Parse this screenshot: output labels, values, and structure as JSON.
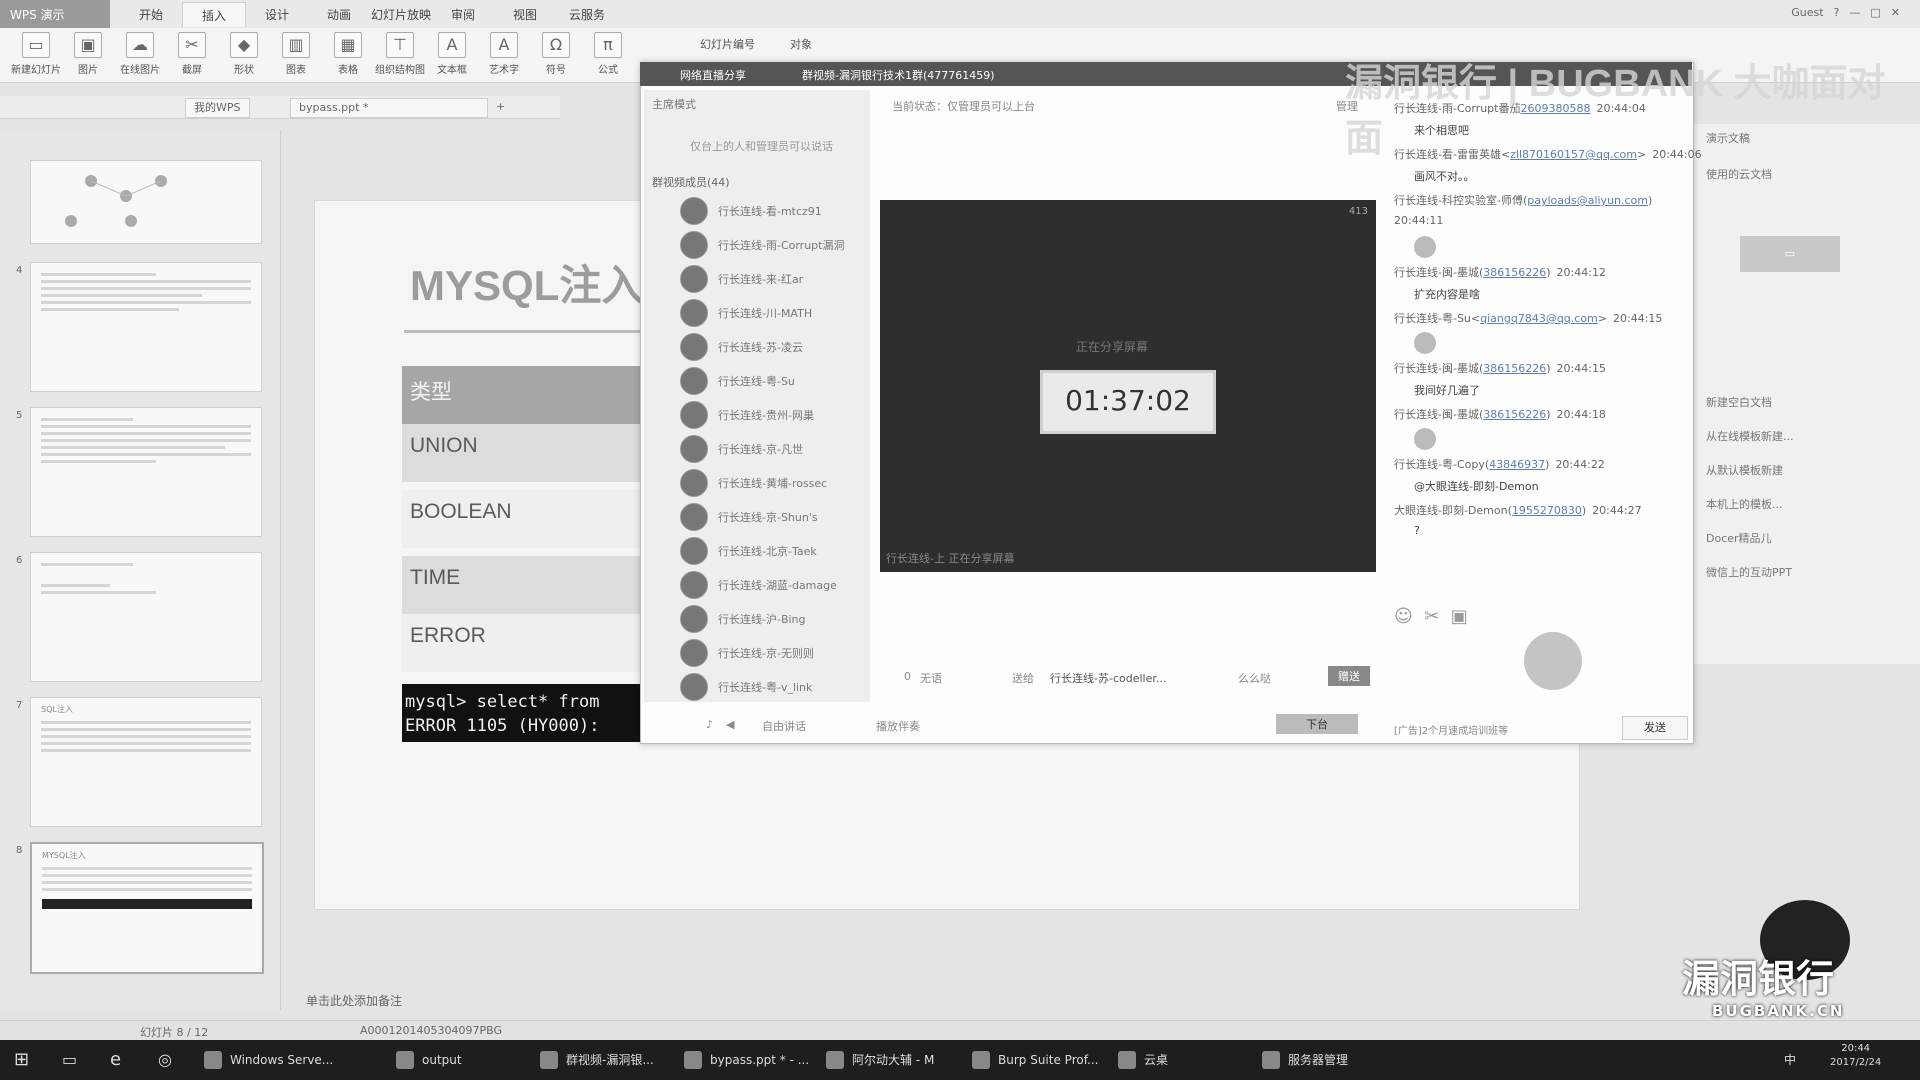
{
  "wps": {
    "app_title": "WPS 演示",
    "menu_tabs": [
      "开始",
      "插入",
      "设计",
      "动画",
      "幻灯片放映",
      "审阅",
      "视图",
      "云服务"
    ],
    "active_tab": "插入",
    "user": "Guest",
    "ribbon": [
      {
        "label": "新建幻灯片",
        "icon": "new-slide-icon",
        "glyph": "▭"
      },
      {
        "label": "图片",
        "icon": "picture-icon",
        "glyph": "▣"
      },
      {
        "label": "在线图片",
        "icon": "online-picture-icon",
        "glyph": "☁"
      },
      {
        "label": "截屏",
        "icon": "screenshot-icon",
        "glyph": "✂"
      },
      {
        "label": "形状",
        "icon": "shape-icon",
        "glyph": "◆"
      },
      {
        "label": "图表",
        "icon": "chart-icon",
        "glyph": "▥"
      },
      {
        "label": "表格",
        "icon": "table-icon",
        "glyph": "▦"
      },
      {
        "label": "组织结构图",
        "icon": "org-chart-icon",
        "glyph": "⊤"
      },
      {
        "label": "文本框",
        "icon": "textbox-icon",
        "glyph": "A"
      },
      {
        "label": "艺术字",
        "icon": "wordart-icon",
        "glyph": "A"
      },
      {
        "label": "符号",
        "icon": "symbol-icon",
        "glyph": "Ω"
      },
      {
        "label": "公式",
        "icon": "formula-icon",
        "glyph": "π"
      }
    ],
    "ribbon_extra": {
      "slide_number": "幻灯片编号",
      "object": "对象"
    },
    "doc_tabs": [
      "我的WPS",
      "bypass.ppt *"
    ],
    "slide_numbers": [
      "4",
      "5",
      "6",
      "7",
      "8"
    ],
    "thumb_titles": [
      "",
      "",
      "",
      "",
      "SQL注入",
      "MYSQL注入"
    ],
    "slide": {
      "title": "MYSQL注入",
      "rows": [
        "类型",
        "UNION",
        "BOOLEAN",
        "TIME",
        "ERROR"
      ],
      "terminal": [
        "mysql> select* from",
        "ERROR 1105 (HY000):"
      ]
    },
    "notes_placeholder": "单击此处添加备注",
    "status_slide": "幻灯片 8 / 12",
    "status_code": "A0001201405304097PBG",
    "docer_items": [
      "新建空白文档",
      "从在线模板新建...",
      "从默认模板新建",
      "本机上的模板...",
      "Docer精品儿",
      "微信上的互动PPT"
    ],
    "docer_top": "演示文稿",
    "docer_sub": "使用的云文档"
  },
  "qq": {
    "header_left": "网络直播分享",
    "header_title": "群视频-漏洞银行技术1群(477761459)",
    "mode": "主席模式",
    "mode_note": "仅台上的人和管理员可以说话",
    "members_header": "群视频成员(44)",
    "members": [
      "行长连线-看-mtcz91",
      "行长连线-雨-Corrupt漏洞",
      "行长连线-来-红ar",
      "行长连线-川-MATH",
      "行长连线-苏-凌云",
      "行长连线-粤-Su",
      "行长连线-贵州-网巢",
      "行长连线-京-凡世",
      "行长连线-黄埔-rossec",
      "行长连线-京-Shun's",
      "行长连线-北京-Taek",
      "行长连线-湖蓝-damage",
      "行长连线-沪-Bing",
      "行长连线-京-无则则",
      "行长连线-粤-v_link"
    ],
    "status": "当前状态：仅管理员可以上台",
    "manage": "管理",
    "viewers": "413",
    "share_title": "正在分享屏幕",
    "timer": "01:37:02",
    "caption": "行长连线-上 正在分享屏幕",
    "bottom": {
      "speech_count": "0",
      "speech_label": "无语",
      "to_label": "送给",
      "to_user": "行长连线-苏-codeller...",
      "gift": "么么哒",
      "send_gift": "赠送",
      "free_talk": "自由讲话",
      "play_music": "播放伴奏",
      "stage_button": "下台",
      "ad": "[广告]2个月速成培训班等",
      "send": "发送"
    },
    "chat": [
      {
        "who": "行长连线-雨-Corrupt番茄",
        "id": "2609380588",
        "time": "20:44:04"
      },
      {
        "msg": "来个相思吧"
      },
      {
        "who": "行长连线-看-雷雷英雄<",
        "id": "zll870160157@qq.com",
        "time": "20:44:06",
        "suffix": ">"
      },
      {
        "msg": "画风不对。。"
      },
      {
        "who": "行长连线-科控实验室-师傅(",
        "id": "payloads@aliyun.com",
        "suffix": ")"
      },
      {
        "time_only": "20:44:11"
      },
      {
        "sticker": true
      },
      {
        "who": "行长连线-闽-墨城(",
        "id": "386156226",
        "time": "20:44:12",
        "suffix": ")"
      },
      {
        "msg": "扩充内容是啥"
      },
      {
        "who": "行长连线-粤-Su<",
        "id": "qiangq7843@qq.com",
        "time": "20:44:15",
        "suffix": ">"
      },
      {
        "sticker": true
      },
      {
        "who": "行长连线-闽-墨城(",
        "id": "386156226",
        "time": "20:44:15",
        "suffix": ")"
      },
      {
        "msg": "我间好几遍了"
      },
      {
        "who": "行长连线-闽-墨城(",
        "id": "386156226",
        "time": "20:44:18",
        "suffix": ")"
      },
      {
        "sticker": true
      },
      {
        "who": "行长连线-粤-Copy(",
        "id": "43846937",
        "time": "20:44:22",
        "suffix": ")"
      },
      {
        "msg": "@大眼连线-即刻-Demon"
      },
      {
        "who": "大眼连线-即刻-Demon(",
        "id": "1955270830",
        "time": "20:44:27",
        "suffix": ")"
      },
      {
        "msg": "?"
      }
    ]
  },
  "watermark": {
    "top": "漏洞银行 | BUGBANK 大咖面对面",
    "bottom_cn": "漏洞银行",
    "bottom_en": "BUGBANK.CN"
  },
  "taskbar": {
    "items": [
      "Windows Serve...",
      "output",
      "群视频-漏洞银...",
      "bypass.ppt * - ...",
      "阿尔动大辅 - M",
      "Burp Suite Prof...",
      "云桌",
      "服务器管理"
    ],
    "clock_time": "20:44",
    "clock_date": "2017/2/24",
    "ime": "中"
  }
}
